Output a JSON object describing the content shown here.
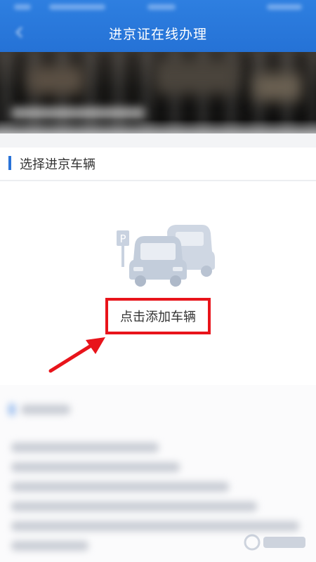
{
  "header": {
    "title": "进京证在线办理"
  },
  "section": {
    "title": "选择进京车辆"
  },
  "vehicle": {
    "add_label": "点击添加车辆"
  },
  "icons": {
    "back": "back-arrow-icon",
    "cars": "parked-cars-icon",
    "annotation": "red-arrow-icon"
  },
  "colors": {
    "header": "#2a78dc",
    "accent": "#2a73d8",
    "highlight": "#e8141b"
  }
}
